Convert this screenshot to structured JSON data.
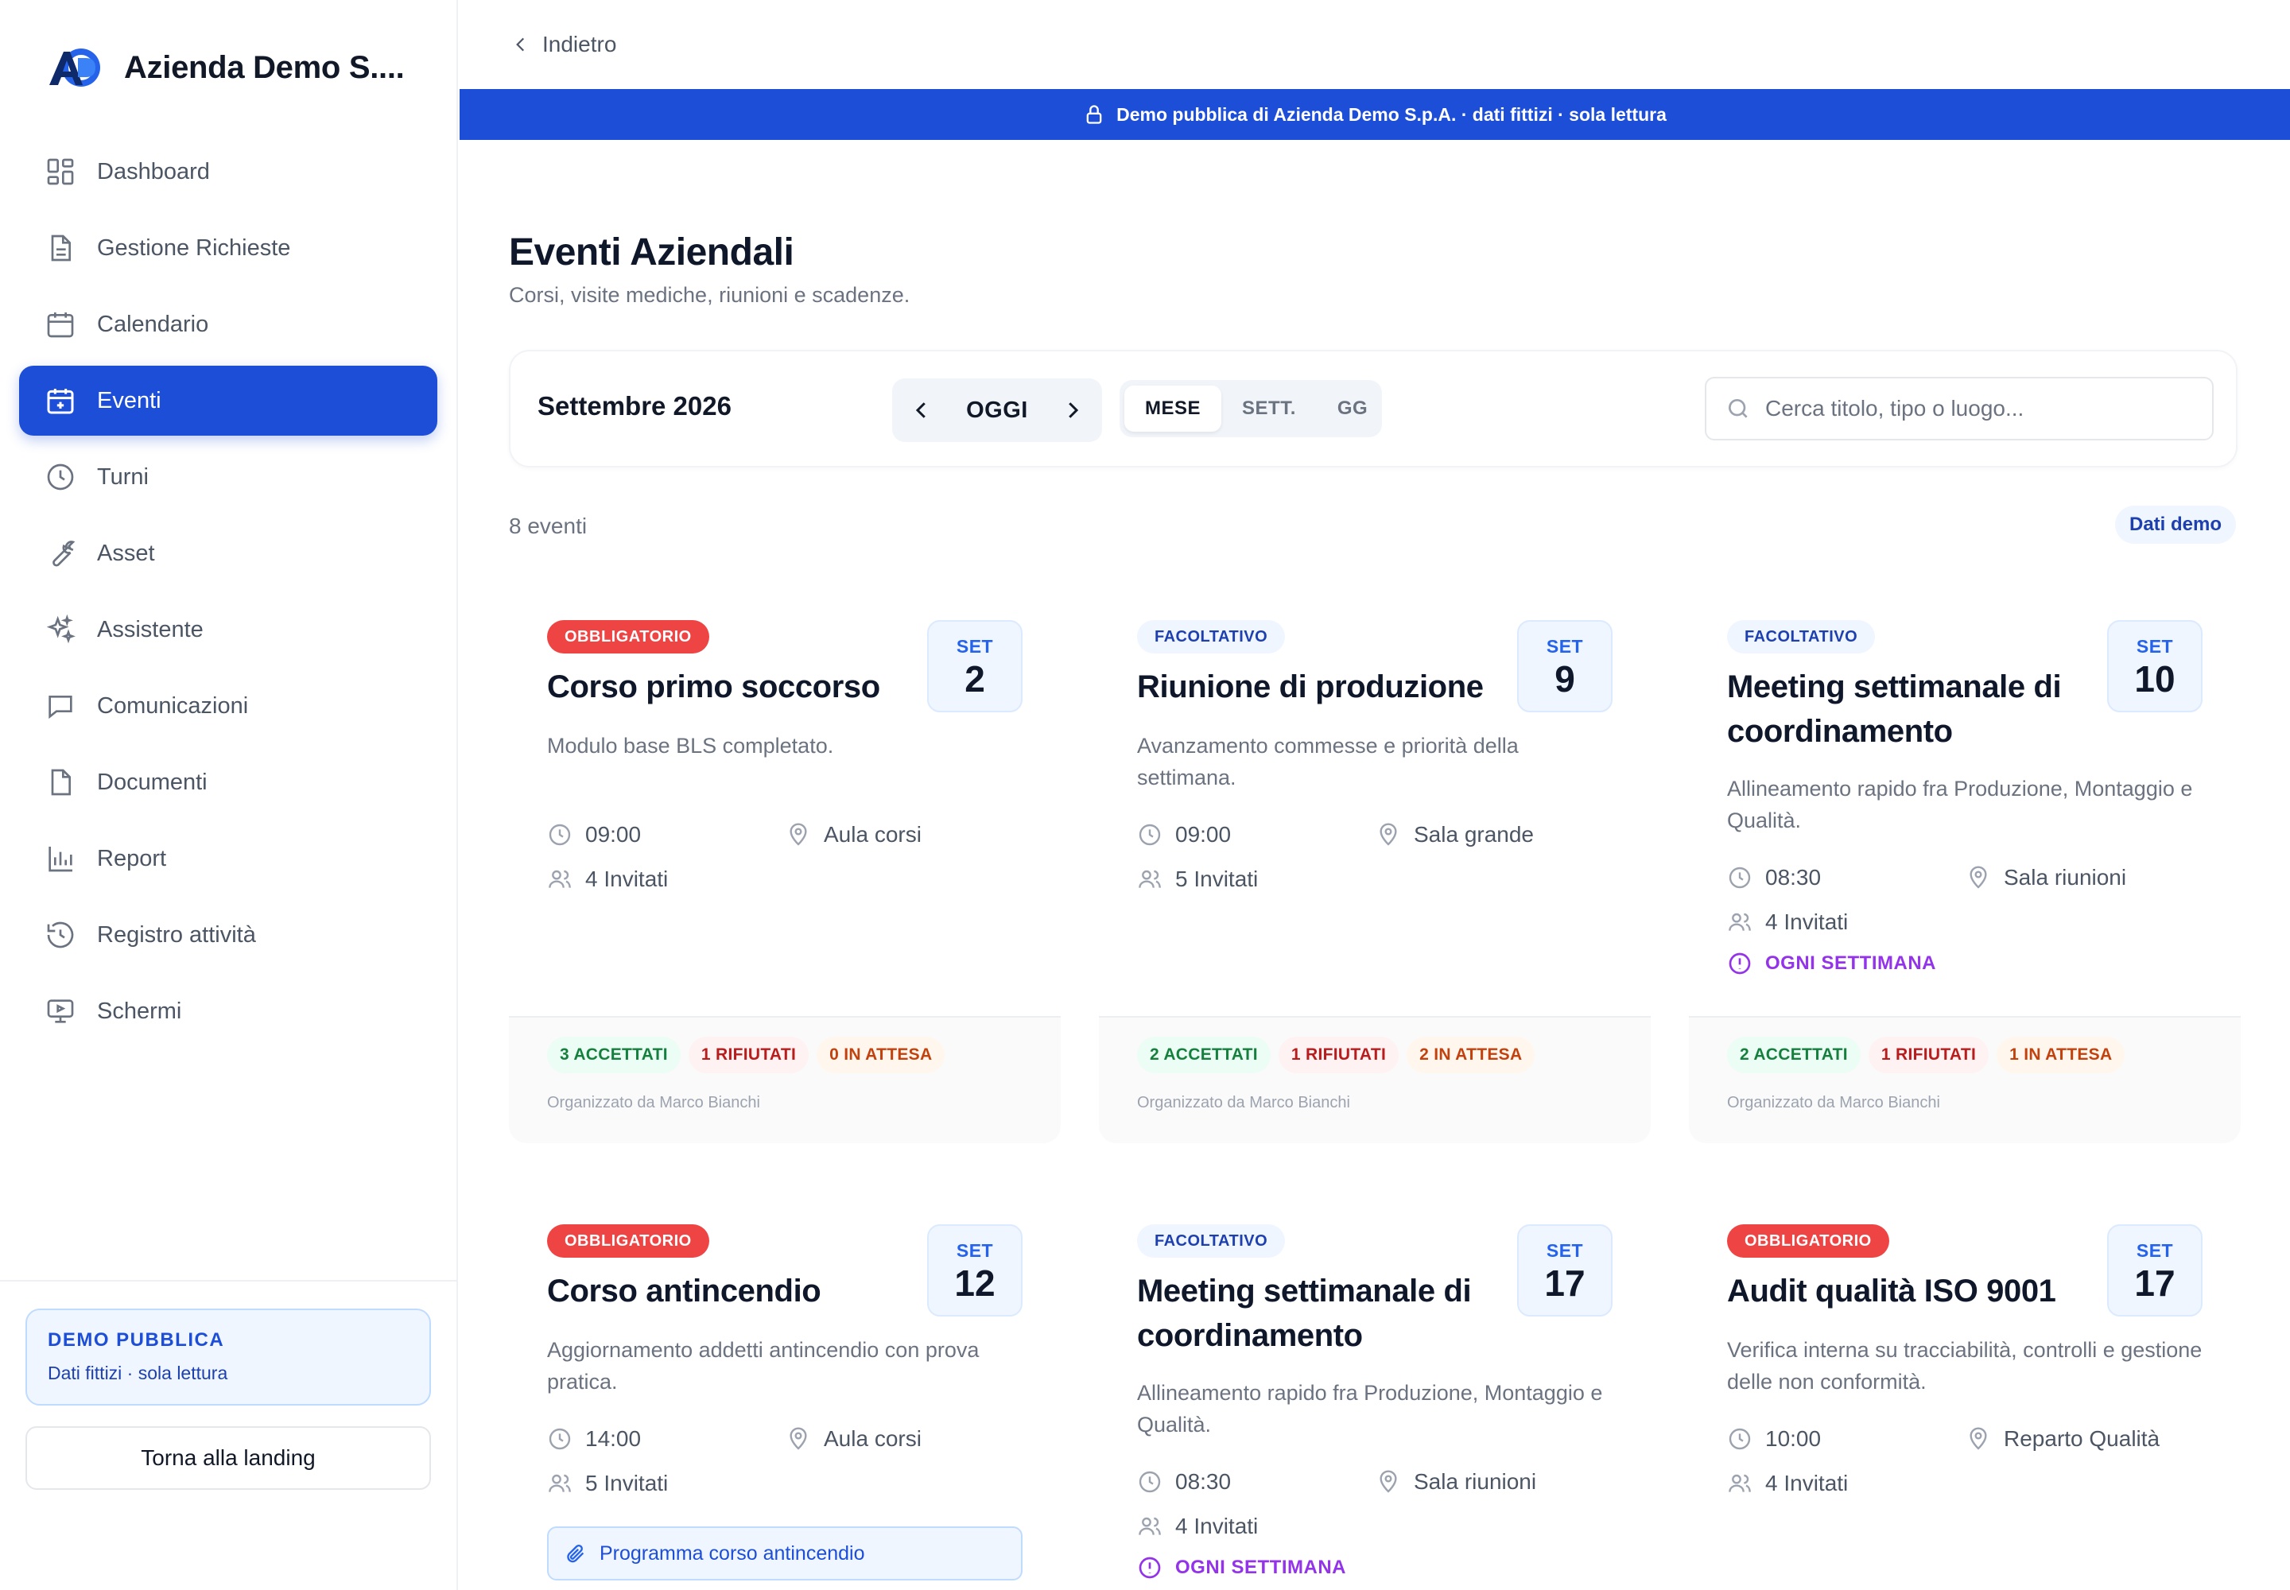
{
  "app": {
    "name": "Azienda Demo S...."
  },
  "sidebar": {
    "items": [
      {
        "label": "Dashboard",
        "icon": "dashboard-icon"
      },
      {
        "label": "Gestione Richieste",
        "icon": "document-icon"
      },
      {
        "label": "Calendario",
        "icon": "calendar-icon"
      },
      {
        "label": "Eventi",
        "icon": "calendar-plus-icon",
        "active": true
      },
      {
        "label": "Turni",
        "icon": "clock-icon"
      },
      {
        "label": "Asset",
        "icon": "wrench-icon"
      },
      {
        "label": "Assistente",
        "icon": "sparkles-icon"
      },
      {
        "label": "Comunicazioni",
        "icon": "chat-icon"
      },
      {
        "label": "Documenti",
        "icon": "file-icon"
      },
      {
        "label": "Report",
        "icon": "bar-chart-icon"
      },
      {
        "label": "Registro attività",
        "icon": "history-icon"
      },
      {
        "label": "Schermi",
        "icon": "monitor-icon"
      }
    ],
    "demo": {
      "title": "DEMO PUBBLICA",
      "subtitle": "Dati fittizi · sola lettura"
    },
    "back_landing": "Torna alla landing"
  },
  "topbar": {
    "back": "Indietro"
  },
  "banner": {
    "text": "Demo pubblica di Azienda Demo S.p.A. · dati fittizi · sola lettura"
  },
  "page": {
    "title": "Eventi Aziendali",
    "subtitle": "Corsi, visite mediche, riunioni e scadenze."
  },
  "toolbar": {
    "month": "Settembre 2026",
    "today": "OGGI",
    "views": [
      "MESE",
      "SETT.",
      "GG"
    ],
    "active_view": "MESE",
    "search_placeholder": "Cerca titolo, tipo o luogo...",
    "search_value": ""
  },
  "summary": {
    "count": "8 eventi",
    "demo_badge": "Dati demo"
  },
  "events": [
    {
      "badge": "OBBLIGATORIO",
      "kind": "req",
      "month": "SET",
      "day": "2",
      "title": "Corso primo soccorso",
      "description": "Modulo base BLS completato.",
      "time": "09:00",
      "location": "Aula corsi",
      "invited": "4 Invitati",
      "recurrence": "",
      "attachment": "",
      "accepted": "3 ACCETTATI",
      "refused": "1 RIFIUTATI",
      "pending": "0 IN ATTESA",
      "organizer": "Organizzato da Marco Bianchi"
    },
    {
      "badge": "FACOLTATIVO",
      "kind": "opt",
      "month": "SET",
      "day": "9",
      "title": "Riunione di produzione",
      "description": "Avanzamento commesse e priorità della settimana.",
      "time": "09:00",
      "location": "Sala grande",
      "invited": "5 Invitati",
      "recurrence": "",
      "attachment": "",
      "accepted": "2 ACCETTATI",
      "refused": "1 RIFIUTATI",
      "pending": "2 IN ATTESA",
      "organizer": "Organizzato da Marco Bianchi"
    },
    {
      "badge": "FACOLTATIVO",
      "kind": "opt",
      "month": "SET",
      "day": "10",
      "title": "Meeting settimanale di coordinamento",
      "description": "Allineamento rapido fra Produzione, Montaggio e Qualità.",
      "time": "08:30",
      "location": "Sala riunioni",
      "invited": "4 Invitati",
      "recurrence": "OGNI SETTIMANA",
      "attachment": "",
      "accepted": "2 ACCETTATI",
      "refused": "1 RIFIUTATI",
      "pending": "1 IN ATTESA",
      "organizer": "Organizzato da Marco Bianchi"
    },
    {
      "badge": "OBBLIGATORIO",
      "kind": "req",
      "month": "SET",
      "day": "12",
      "title": "Corso antincendio",
      "description": "Aggiornamento addetti antincendio con prova pratica.",
      "time": "14:00",
      "location": "Aula corsi",
      "invited": "5 Invitati",
      "recurrence": "",
      "attachment": "Programma corso antincendio"
    },
    {
      "badge": "FACOLTATIVO",
      "kind": "opt",
      "month": "SET",
      "day": "17",
      "title": "Meeting settimanale di coordinamento",
      "description": "Allineamento rapido fra Produzione, Montaggio e Qualità.",
      "time": "08:30",
      "location": "Sala riunioni",
      "invited": "4 Invitati",
      "recurrence": "OGNI SETTIMANA",
      "attachment": ""
    },
    {
      "badge": "OBBLIGATORIO",
      "kind": "req",
      "month": "SET",
      "day": "17",
      "title": "Audit qualità ISO 9001",
      "description": "Verifica interna su tracciabilità, controlli e gestione delle non conformità.",
      "time": "10:00",
      "location": "Reparto Qualità",
      "invited": "4 Invitati",
      "recurrence": "",
      "attachment": ""
    }
  ]
}
